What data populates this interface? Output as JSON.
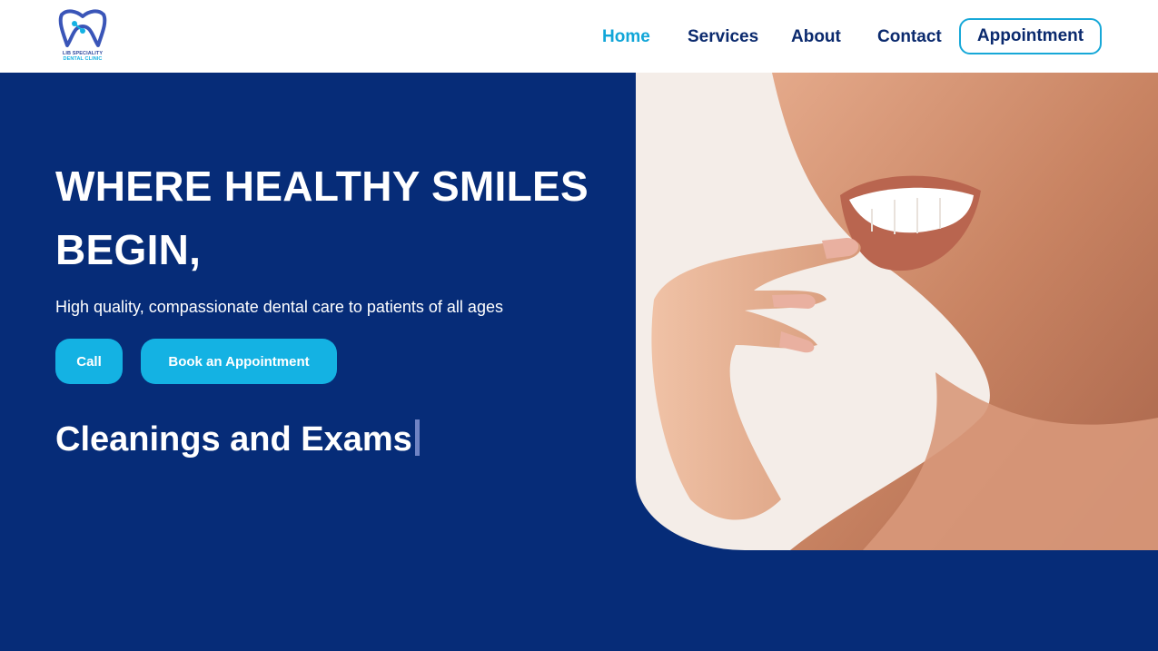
{
  "brand": {
    "logo_text_line1": "LIB SPECIALITY",
    "logo_text_line2": "DENTAL CLINIC",
    "logo_icon": "tooth-logo-icon"
  },
  "nav": {
    "items": [
      {
        "label": "Home",
        "active": true
      },
      {
        "label": "Services",
        "active": false
      },
      {
        "label": "About",
        "active": false
      },
      {
        "label": "Contact",
        "active": false
      }
    ],
    "cta_label": "Appointment"
  },
  "hero": {
    "title": "WHERE HEALTHY SMILES BEGIN,",
    "subtitle": "High quality, compassionate dental care to patients of all ages",
    "call_label": "Call",
    "book_label": "Book an Appointment",
    "typed_text": "Cleanings and Exams"
  },
  "colors": {
    "primary_dark": "#062c78",
    "accent": "#14b2e3",
    "nav_text": "#0b2a6e",
    "nav_active": "#12a6d8"
  }
}
